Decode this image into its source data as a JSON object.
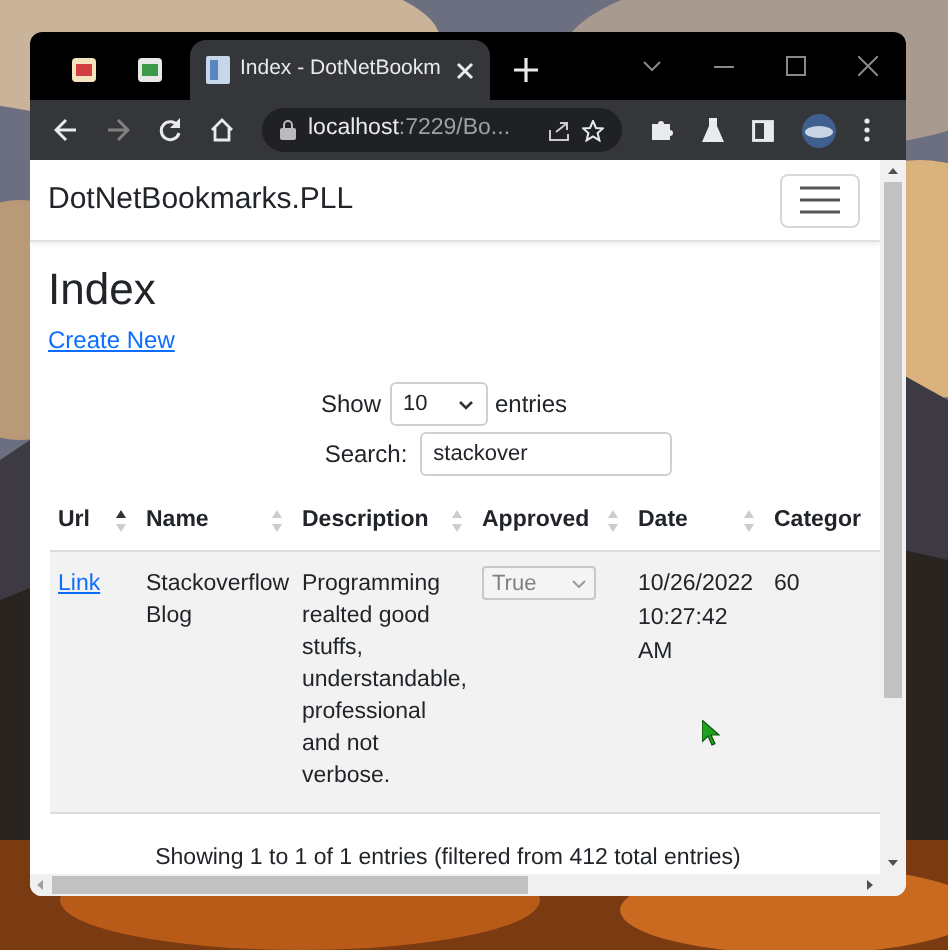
{
  "browser": {
    "tabs": [
      {
        "kind": "pinned",
        "selected": false
      },
      {
        "kind": "pinned",
        "selected": false
      },
      {
        "kind": "page",
        "title": "Index - DotNetBookm",
        "selected": true
      }
    ],
    "address": {
      "host": "localhost",
      "rest": ":7229/Bo..."
    }
  },
  "page": {
    "brand": "DotNetBookmarks.PLL",
    "heading": "Index",
    "create_link": "Create New",
    "length": {
      "before": "Show",
      "value": "10",
      "after": "entries"
    },
    "search": {
      "label": "Search:",
      "value": "stackover"
    },
    "table": {
      "columns": [
        {
          "label": "Url",
          "sorted_ascending": true
        },
        {
          "label": "Name",
          "sorted_ascending": false
        },
        {
          "label": "Description",
          "sorted_ascending": false
        },
        {
          "label": "Approved",
          "sorted_ascending": false
        },
        {
          "label": "Date",
          "sorted_ascending": false
        },
        {
          "label": "Categor"
        }
      ],
      "rows": [
        {
          "url": "Link",
          "name": "Stackoverflow Blog",
          "description": "Programming realted good stuffs, understandable, professional and not verbose.",
          "approved": {
            "value": "True",
            "disabled": true
          },
          "date": "10/26/2022 10:27:42 AM",
          "category": "60"
        }
      ]
    },
    "info": "Showing 1 to 1 of 1 entries (filtered from 412 total entries)"
  }
}
